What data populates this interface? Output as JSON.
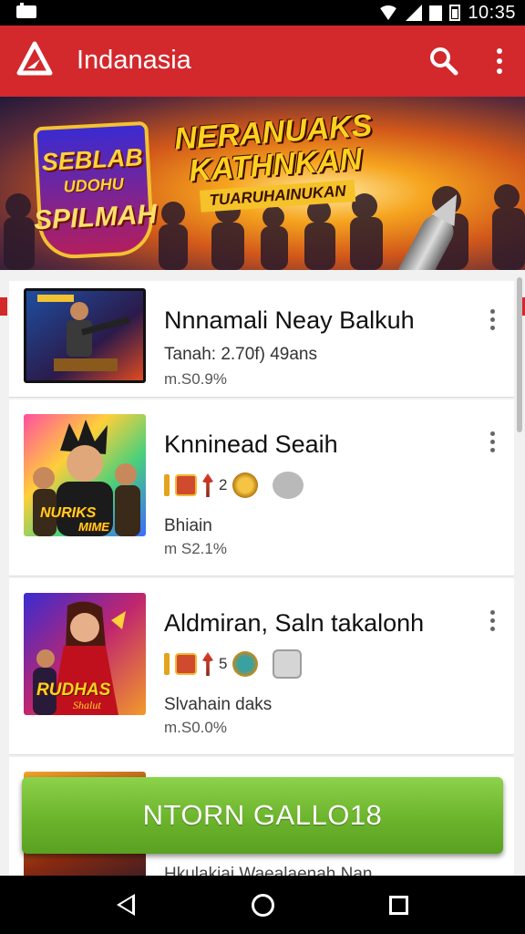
{
  "status_bar": {
    "time": "10:35"
  },
  "app_bar": {
    "title": "Indanasia",
    "brand_color": "#d3282c"
  },
  "banner": {
    "badge_line1": "SEBLAB",
    "badge_line2": "UDOHU",
    "badge_line3": "SPILMAH",
    "headline_line1": "NERANUAKS",
    "headline_line2": "KATHNKAN",
    "headline_sub": "TUARUHAINUKAN"
  },
  "list": {
    "items": [
      {
        "title": "Nnnamali Neay Balkuh",
        "meta": "Tanah: 2.70f) 49ans",
        "meta2": "m.S0.9%"
      },
      {
        "title": "Knninead Seaih",
        "icons_count": "2",
        "meta": "Bhiain",
        "meta2": "m S2.1%",
        "thumb_text_1": "NURIKS",
        "thumb_text_2": "MIME"
      },
      {
        "title": "Aldmiran, Saln takalonh",
        "icons_count": "5",
        "meta": "Slvahain daks",
        "meta2": "m.S0.0%",
        "thumb_text_1": "RUDHAS",
        "thumb_text_2": "Shalut"
      },
      {
        "peek_text": "Hkulakiai Waealaenah Nan"
      }
    ]
  },
  "cta": {
    "label": "NTORN GALLO18",
    "color": "#6cb42c"
  },
  "icons": {
    "status_left": "notification-icon",
    "wifi": "wifi-icon",
    "signal": "signal-icon",
    "search": "search-icon",
    "menu": "more-vert-icon",
    "back": "back-icon",
    "home": "home-icon",
    "recent": "recents-icon"
  }
}
